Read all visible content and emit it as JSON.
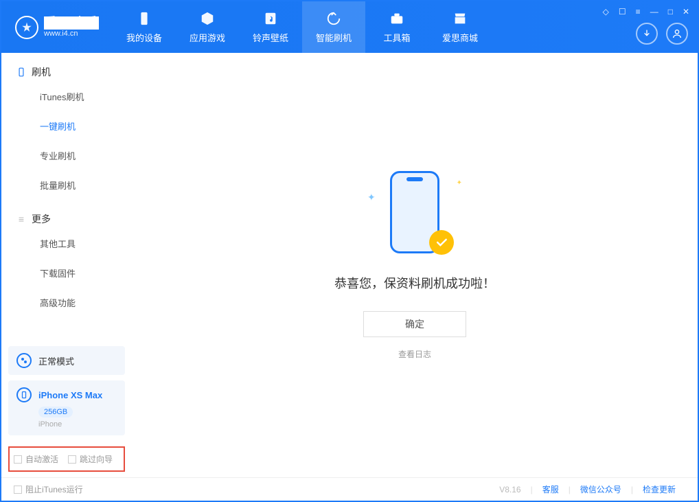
{
  "header": {
    "logo_main": "爱思助手",
    "logo_sub": "www.i4.cn",
    "tabs": [
      {
        "label": "我的设备"
      },
      {
        "label": "应用游戏"
      },
      {
        "label": "铃声壁纸"
      },
      {
        "label": "智能刷机"
      },
      {
        "label": "工具箱"
      },
      {
        "label": "爱思商城"
      }
    ]
  },
  "sidebar": {
    "section1": "刷机",
    "items1": [
      {
        "label": "iTunes刷机"
      },
      {
        "label": "一键刷机"
      },
      {
        "label": "专业刷机"
      },
      {
        "label": "批量刷机"
      }
    ],
    "section2": "更多",
    "items2": [
      {
        "label": "其他工具"
      },
      {
        "label": "下载固件"
      },
      {
        "label": "高级功能"
      }
    ],
    "mode_label": "正常模式",
    "device_name": "iPhone XS Max",
    "device_storage": "256GB",
    "device_type": "iPhone",
    "cb_auto_activate": "自动激活",
    "cb_skip_guide": "跳过向导"
  },
  "main": {
    "success_msg": "恭喜您，保资料刷机成功啦！",
    "ok_btn": "确定",
    "log_link": "查看日志"
  },
  "footer": {
    "block_itunes": "阻止iTunes运行",
    "version": "V8.16",
    "links": [
      "客服",
      "微信公众号",
      "检查更新"
    ]
  }
}
